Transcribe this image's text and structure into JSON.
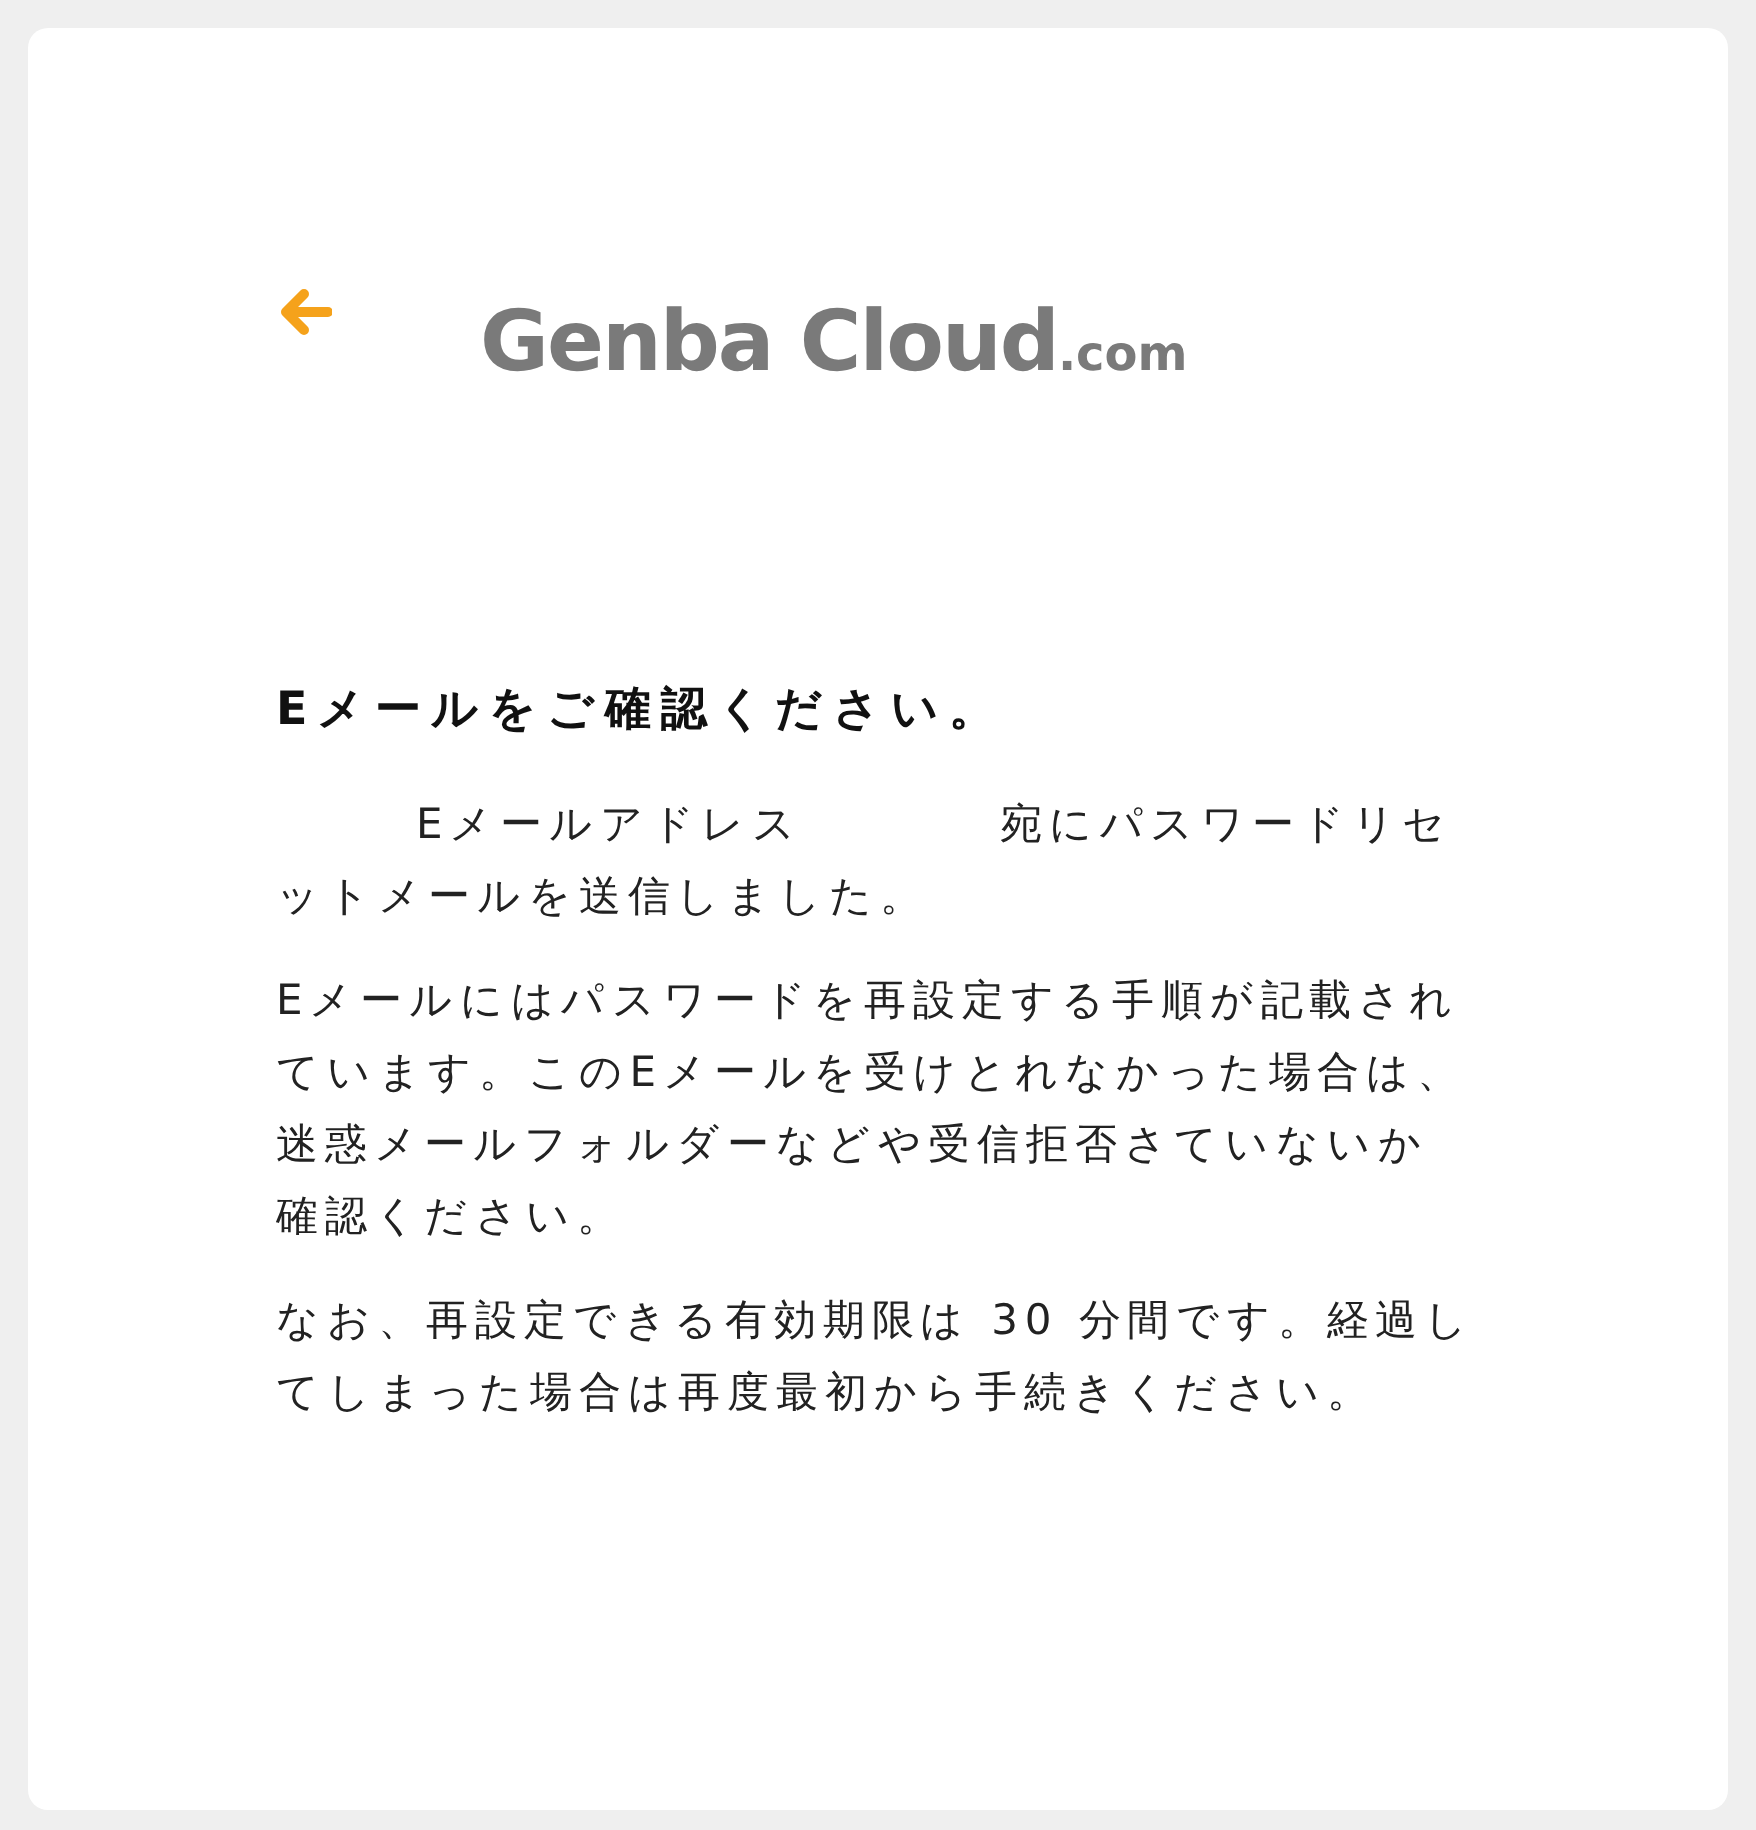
{
  "back_button": {
    "kind": "arrow"
  },
  "logo": {
    "name": "Genba",
    "second": "Cloud",
    "suffix": ".com"
  },
  "heading": "Eメールをご確認ください。",
  "message": {
    "email": "Eメールアドレス",
    "text": "宛にパスワードリセットメールを送信しました。"
  },
  "paragraphs": [
    "Eメールにはパスワードを再設定する手順が記載されています。このEメールを受けとれなかった場合は、迷惑メールフォルダーなどや受信拒否さていないか確認ください。",
    "なお、再設定できる有効期限は 30 分間です。経過してしまった場合は再度最初から手続きください。"
  ]
}
